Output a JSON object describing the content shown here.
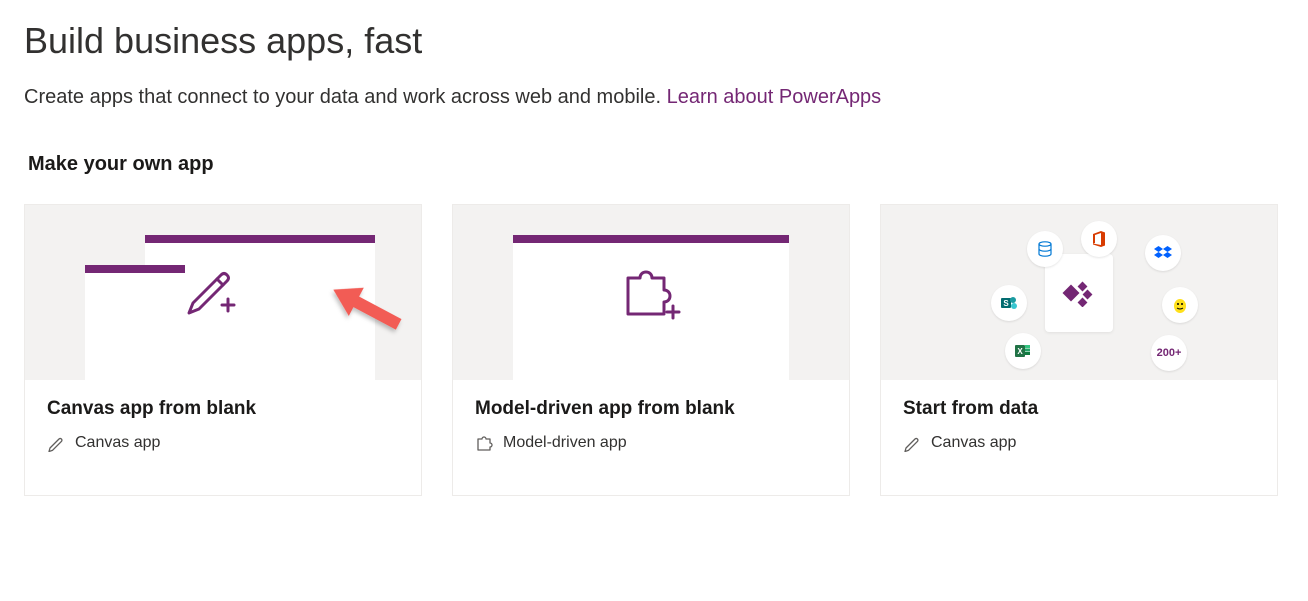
{
  "hero": {
    "title": "Build business apps, fast",
    "subtitle_prefix": "Create apps that connect to your data and work across web and mobile. ",
    "link_text": "Learn about PowerApps"
  },
  "section": {
    "heading": "Make your own app"
  },
  "cards": [
    {
      "title": "Canvas app from blank",
      "type_label": "Canvas app",
      "type_icon": "pencil"
    },
    {
      "title": "Model-driven app from blank",
      "type_label": "Model-driven app",
      "type_icon": "puzzle"
    },
    {
      "title": "Start from data",
      "type_label": "Canvas app",
      "type_icon": "pencil",
      "orbit_badge": "200+"
    }
  ],
  "colors": {
    "accent": "#742774",
    "link": "#742774",
    "arrow": "#f25c54"
  }
}
